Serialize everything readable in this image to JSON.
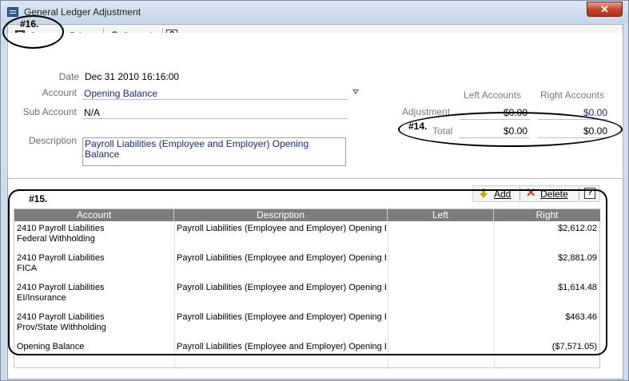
{
  "window": {
    "title": "General Ledger Adjustment",
    "close_glyph": "✕"
  },
  "toolbar": {
    "save_label": "Save",
    "print_label": "Print",
    "print_arrow": "▾",
    "cancel_label": "Cancel",
    "undo_glyph": "↶",
    "help_glyph": "?"
  },
  "annotations": {
    "a16": "#16.",
    "a15": "#15.",
    "a14": "#14."
  },
  "form": {
    "date_label": "Date",
    "date_value": "Dec 31 2010 16:16:00",
    "account_label": "Account",
    "account_value": "Opening Balance",
    "subaccount_label": "Sub Account",
    "subaccount_value": "N/A",
    "description_label": "Description",
    "description_value": "Payroll Liabilities (Employee and Employer) Opening Balance"
  },
  "totals": {
    "left_header": "Left Accounts",
    "right_header": "Right Accounts",
    "adjustment_label": "Adjustment",
    "adjustment_left": "$0.00",
    "adjustment_right": "$0.00",
    "total_label": "Total",
    "total_left": "$0.00",
    "total_right": "$0.00"
  },
  "grid_toolbar": {
    "add_label": "Add",
    "delete_label": "Delete",
    "delete_glyph": "✕",
    "help_glyph": "?"
  },
  "grid": {
    "columns": [
      "Account",
      "Description",
      "Left",
      "Right"
    ],
    "rows": [
      {
        "account_line1": "2410 Payroll Liabilities",
        "account_line2": "Federal Withholding",
        "description": "Payroll Liabilities (Employee and Employer) Opening Ba",
        "left": "",
        "right": "$2,612.02"
      },
      {
        "account_line1": "2410 Payroll Liabilities",
        "account_line2": "FICA",
        "description": "Payroll Liabilities (Employee and Employer) Opening Ba",
        "left": "",
        "right": "$2,881.09"
      },
      {
        "account_line1": "2410 Payroll Liabilities",
        "account_line2": "EI/Insurance",
        "description": "Payroll Liabilities (Employee and Employer) Opening Ba",
        "left": "",
        "right": "$1,614.48"
      },
      {
        "account_line1": "2410 Payroll Liabilities",
        "account_line2": "Prov/State Withholding",
        "description": "Payroll Liabilities (Employee and Employer) Opening Ba",
        "left": "",
        "right": "$463.46"
      },
      {
        "account_line1": "Opening Balance",
        "account_line2": "",
        "description": "Payroll Liabilities (Employee and Employer) Opening Ba",
        "left": "",
        "right": "($7,571.05)"
      }
    ]
  }
}
